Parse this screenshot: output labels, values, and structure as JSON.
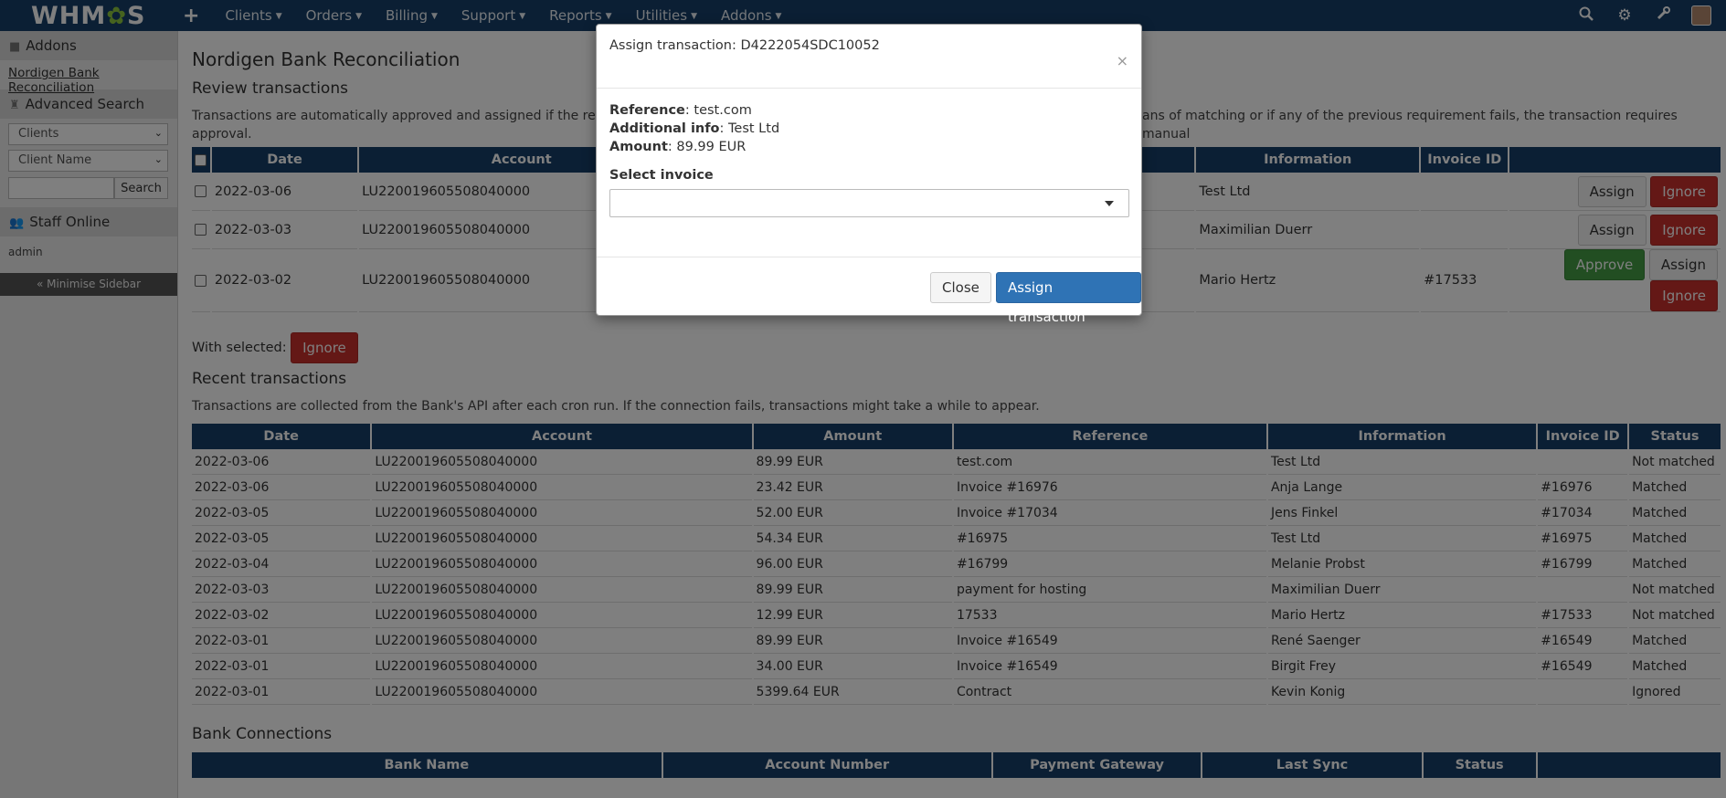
{
  "topbar": {
    "logo": "WHMCS",
    "plus": "+",
    "nav": [
      "Clients",
      "Orders",
      "Billing",
      "Support",
      "Reports",
      "Utilities",
      "Addons"
    ],
    "icons": [
      "search-icon",
      "gears-icon",
      "wrench-icon"
    ]
  },
  "sidebar": {
    "addons_title": "Addons",
    "addon_link": "Nordigen Bank Reconciliation",
    "search_title": "Advanced Search",
    "search_type": "Clients",
    "search_field": "Client Name",
    "search_button": "Search",
    "staff_title": "Staff Online",
    "staff_user": "admin",
    "minimise": "« Minimise Sidebar"
  },
  "page": {
    "title": "Nordigen Bank Reconciliation",
    "review_title": "Review transactions",
    "review_desc_1": "Transactions are automatically approved and assigned if the referen",
    "review_desc_1b": "ans of matching or if any of the previous requirement fails, the transaction requires manual",
    "review_desc_2": "approval.",
    "review_headers": [
      "Date",
      "Account",
      "Information",
      "Invoice ID"
    ],
    "review_rows": [
      {
        "date": "2022-03-06",
        "account": "LU220019605508040000",
        "info": "Test Ltd",
        "invoice": ""
      },
      {
        "date": "2022-03-03",
        "account": "LU220019605508040000",
        "info": "Maximilian Duerr",
        "invoice": ""
      },
      {
        "date": "2022-03-02",
        "account": "LU220019605508040000",
        "info": "Mario Hertz",
        "invoice": "#17533"
      }
    ],
    "btn_assign": "Assign",
    "btn_ignore": "Ignore",
    "btn_approve": "Approve",
    "with_selected": "With selected:",
    "recent_title": "Recent transactions",
    "recent_desc": "Transactions are collected from the Bank's API after each cron run. If the connection fails, transactions might take a while to appear.",
    "recent_headers": [
      "Date",
      "Account",
      "Amount",
      "Reference",
      "Information",
      "Invoice ID",
      "Status"
    ],
    "recent_rows": [
      [
        "2022-03-06",
        "LU220019605508040000",
        "89.99 EUR",
        "test.com",
        "Test Ltd",
        "",
        "Not matched"
      ],
      [
        "2022-03-06",
        "LU220019605508040000",
        "23.42 EUR",
        "Invoice #16976",
        "Anja Lange",
        "#16976",
        "Matched"
      ],
      [
        "2022-03-05",
        "LU220019605508040000",
        "52.00 EUR",
        "Invoice #17034",
        "Jens Finkel",
        "#17034",
        "Matched"
      ],
      [
        "2022-03-05",
        "LU220019605508040000",
        "54.34 EUR",
        "#16975",
        "Test Ltd",
        "#16975",
        "Matched"
      ],
      [
        "2022-03-04",
        "LU220019605508040000",
        "96.00 EUR",
        "#16799",
        "Melanie Probst",
        "#16799",
        "Matched"
      ],
      [
        "2022-03-03",
        "LU220019605508040000",
        "89.99 EUR",
        "payment for hosting",
        "Maximilian Duerr",
        "",
        "Not matched"
      ],
      [
        "2022-03-02",
        "LU220019605508040000",
        "12.99 EUR",
        "17533",
        "Mario Hertz",
        "#17533",
        "Not matched"
      ],
      [
        "2022-03-01",
        "LU220019605508040000",
        "89.99 EUR",
        "Invoice #16549",
        "René Saenger",
        "#16549",
        "Matched"
      ],
      [
        "2022-03-01",
        "LU220019605508040000",
        "34.00 EUR",
        "Invoice #16549",
        "Birgit Frey",
        "#16549",
        "Matched"
      ],
      [
        "2022-03-01",
        "LU220019605508040000",
        "5399.64 EUR",
        "Contract",
        "Kevin Konig",
        "",
        "Ignored"
      ]
    ],
    "bank_title": "Bank Connections",
    "bank_headers": [
      "Bank Name",
      "Account Number",
      "Payment Gateway",
      "Last Sync",
      "Status",
      ""
    ]
  },
  "modal": {
    "title": "Assign transaction: D4222054SDC10052",
    "close_x": "×",
    "reference_label": "Reference",
    "reference_value": "test.com",
    "info_label": "Additional info",
    "info_value": "Test Ltd",
    "amount_label": "Amount",
    "amount_value": "89.99 EUR",
    "select_label": "Select invoice",
    "close_button": "Close",
    "assign_button": "Assign transaction"
  }
}
